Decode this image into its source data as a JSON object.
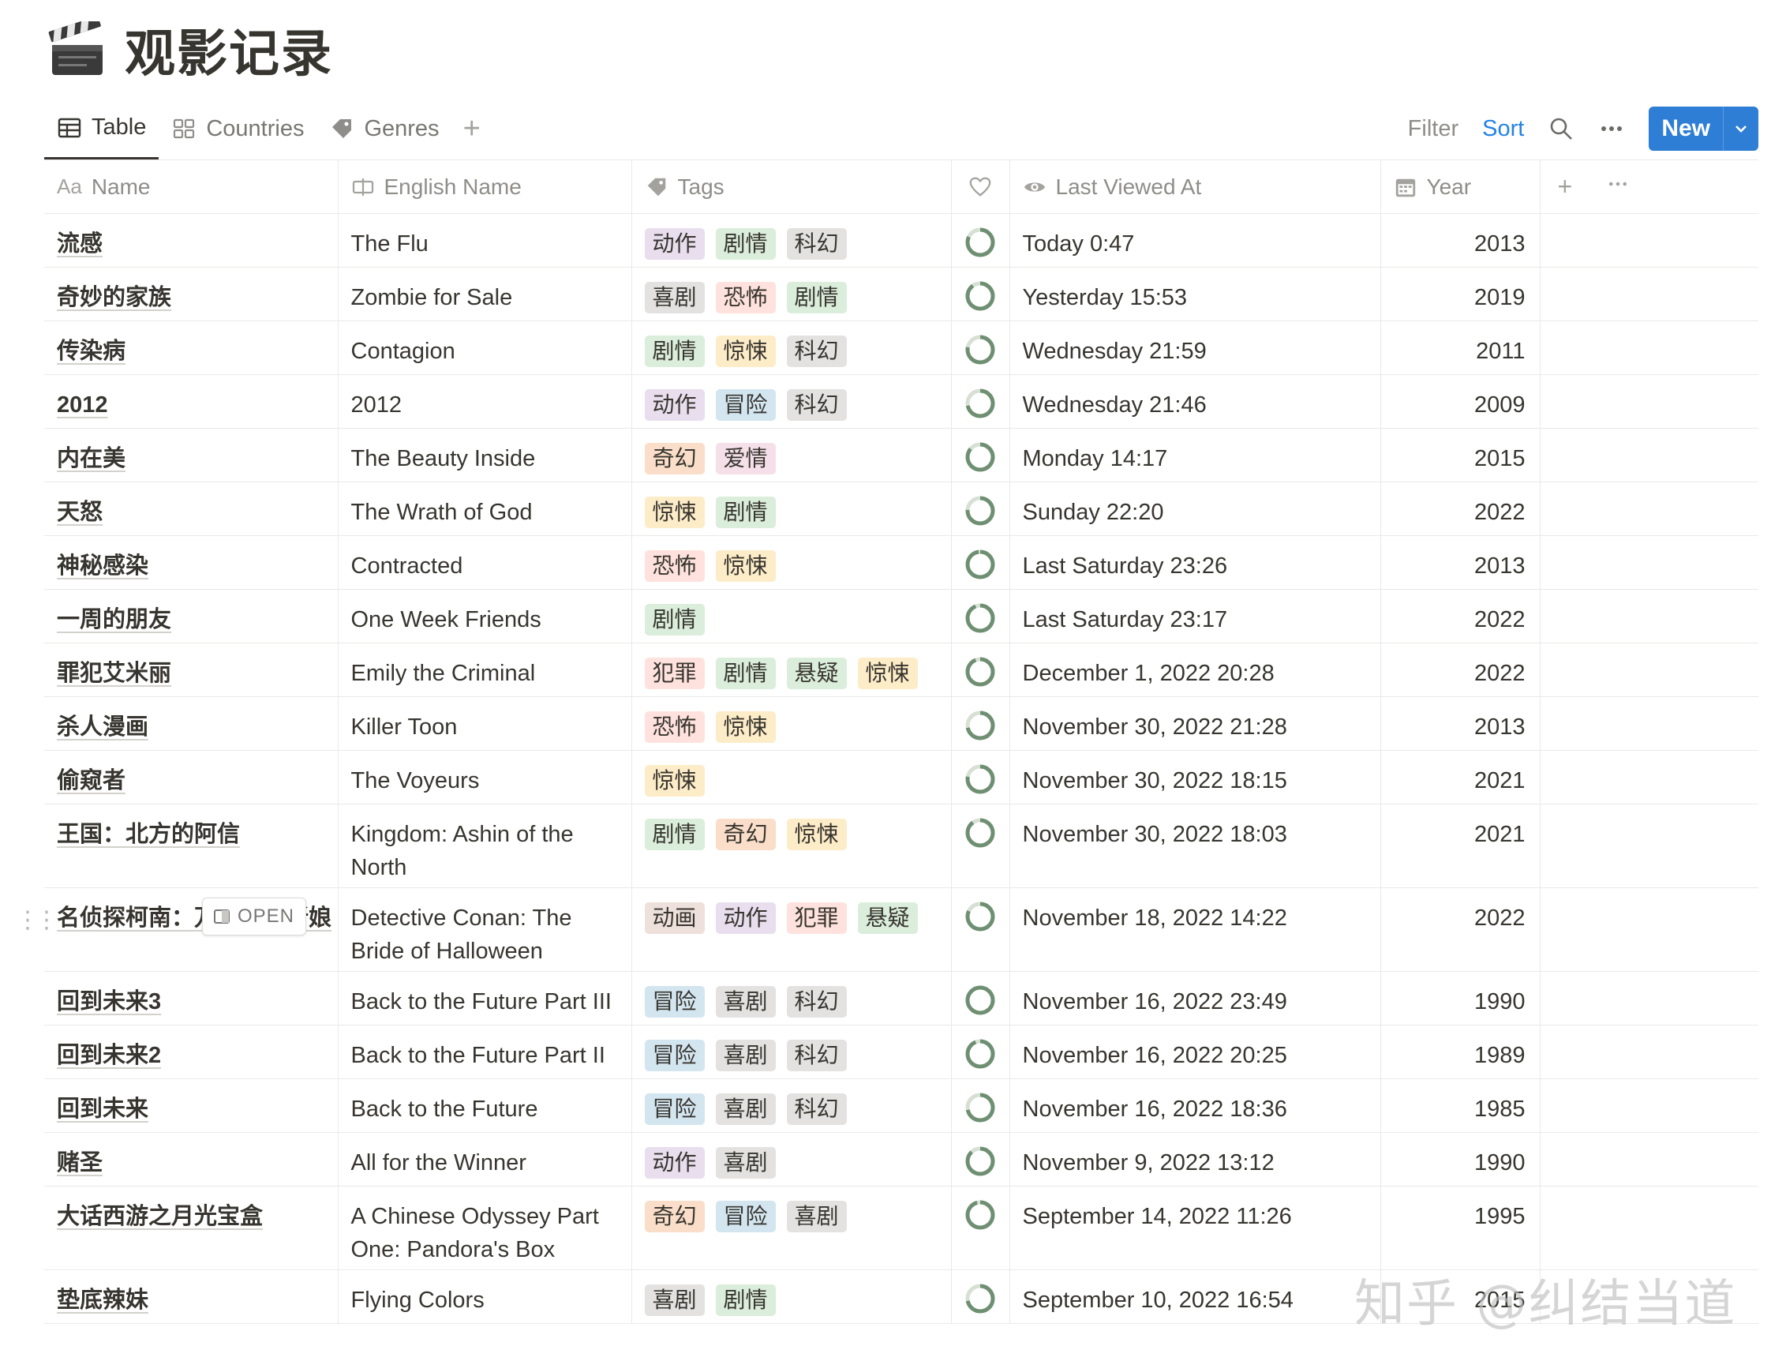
{
  "page": {
    "title": "观影记录",
    "icon": "clapper-board-icon"
  },
  "views": {
    "tabs": [
      {
        "label": "Table",
        "icon": "table-icon",
        "active": true
      },
      {
        "label": "Countries",
        "icon": "gallery-icon",
        "active": false
      },
      {
        "label": "Genres",
        "icon": "tag-icon",
        "active": false
      }
    ],
    "add_label": "+"
  },
  "actions": {
    "filter_label": "Filter",
    "sort_label": "Sort",
    "new_label": "New"
  },
  "columns": [
    {
      "label": "Name",
      "icon": "text-aa-icon"
    },
    {
      "label": "English Name",
      "icon": "text-cursor-icon"
    },
    {
      "label": "Tags",
      "icon": "tag-icon"
    },
    {
      "label": "",
      "icon": "heart-icon"
    },
    {
      "label": "Last Viewed At",
      "icon": "eye-icon"
    },
    {
      "label": "Year",
      "icon": "calendar-icon"
    }
  ],
  "row_open_label": "OPEN",
  "tag_colors": {
    "动作": "#e8deee",
    "剧情": "#dbeddb",
    "科幻": "#e3e2e0",
    "喜剧": "#e3e2e0",
    "恐怖": "#ffe2dd",
    "惊悚": "#fdecc8",
    "冒险": "#d3e5ef",
    "奇幻": "#fadec9",
    "爱情": "#f5e0e9",
    "犯罪": "#ffe2dd",
    "悬疑": "#dbeddb",
    "动画": "#eee0da"
  },
  "rows": [
    {
      "name": "流感",
      "english": [
        "The Flu"
      ],
      "tags": [
        "动作",
        "剧情",
        "科幻"
      ],
      "viewed": "Today 0:47",
      "year": "2013"
    },
    {
      "name": "奇妙的家族",
      "english": [
        "Zombie for Sale"
      ],
      "tags": [
        "喜剧",
        "恐怖",
        "剧情"
      ],
      "viewed": "Yesterday 15:53",
      "year": "2019"
    },
    {
      "name": "传染病",
      "english": [
        "Contagion"
      ],
      "tags": [
        "剧情",
        "惊悚",
        "科幻"
      ],
      "viewed": "Wednesday 21:59",
      "year": "2011"
    },
    {
      "name": "2012",
      "english": [
        "2012"
      ],
      "tags": [
        "动作",
        "冒险",
        "科幻"
      ],
      "viewed": "Wednesday 21:46",
      "year": "2009"
    },
    {
      "name": "内在美",
      "english": [
        "The Beauty Inside"
      ],
      "tags": [
        "奇幻",
        "爱情"
      ],
      "viewed": "Monday 14:17",
      "year": "2015"
    },
    {
      "name": "天怒",
      "english": [
        "The Wrath of God"
      ],
      "tags": [
        "惊悚",
        "剧情"
      ],
      "viewed": "Sunday 22:20",
      "year": "2022"
    },
    {
      "name": "神秘感染",
      "english": [
        "Contracted"
      ],
      "tags": [
        "恐怖",
        "惊悚"
      ],
      "viewed": "Last Saturday 23:26",
      "year": "2013"
    },
    {
      "name": "一周的朋友",
      "english": [
        "One Week Friends"
      ],
      "tags": [
        "剧情"
      ],
      "viewed": "Last Saturday 23:17",
      "year": "2022"
    },
    {
      "name": "罪犯艾米丽",
      "english": [
        "Emily the Criminal"
      ],
      "tags": [
        "犯罪",
        "剧情",
        "悬疑",
        "惊悚"
      ],
      "viewed": "December 1, 2022 20:28",
      "year": "2022"
    },
    {
      "name": "杀人漫画",
      "english": [
        "Killer Toon"
      ],
      "tags": [
        "恐怖",
        "惊悚"
      ],
      "viewed": "November 30, 2022 21:28",
      "year": "2013"
    },
    {
      "name": "偷窥者",
      "english": [
        "The Voyeurs"
      ],
      "tags": [
        "惊悚"
      ],
      "viewed": "November 30, 2022 18:15",
      "year": "2021"
    },
    {
      "name": "王国：北方的阿信",
      "english": [
        "Kingdom: Ashin of the",
        "North"
      ],
      "tags": [
        "剧情",
        "奇幻",
        "惊悚"
      ],
      "viewed": "November 30, 2022 18:03",
      "year": "2021"
    },
    {
      "name": "名侦探柯南：万圣节的新娘",
      "english": [
        "Detective Conan: The",
        "Bride of Halloween"
      ],
      "tags": [
        "动画",
        "动作",
        "犯罪",
        "悬疑"
      ],
      "viewed": "November 18, 2022 14:22",
      "year": "2022",
      "hover": true
    },
    {
      "name": "回到未来3",
      "english": [
        "Back to the Future Part III"
      ],
      "tags": [
        "冒险",
        "喜剧",
        "科幻"
      ],
      "viewed": "November 16, 2022 23:49",
      "year": "1990"
    },
    {
      "name": "回到未来2",
      "english": [
        "Back to the Future Part II"
      ],
      "tags": [
        "冒险",
        "喜剧",
        "科幻"
      ],
      "viewed": "November 16, 2022 20:25",
      "year": "1989"
    },
    {
      "name": "回到未来",
      "english": [
        "Back to the Future"
      ],
      "tags": [
        "冒险",
        "喜剧",
        "科幻"
      ],
      "viewed": "November 16, 2022 18:36",
      "year": "1985"
    },
    {
      "name": "赌圣",
      "english": [
        "All for the Winner"
      ],
      "tags": [
        "动作",
        "喜剧"
      ],
      "viewed": "November 9, 2022 13:12",
      "year": "1990"
    },
    {
      "name": "大话西游之月光宝盒",
      "english": [
        "A Chinese Odyssey Part",
        "One: Pandora's Box"
      ],
      "tags": [
        "奇幻",
        "冒险",
        "喜剧"
      ],
      "viewed": "September 14, 2022 11:26",
      "year": "1995"
    },
    {
      "name": "垫底辣妹",
      "english": [
        "Flying Colors"
      ],
      "tags": [
        "喜剧",
        "剧情"
      ],
      "viewed": "September 10, 2022 16:54",
      "year": "2015"
    }
  ],
  "watermark": "知乎 @纠结当道"
}
